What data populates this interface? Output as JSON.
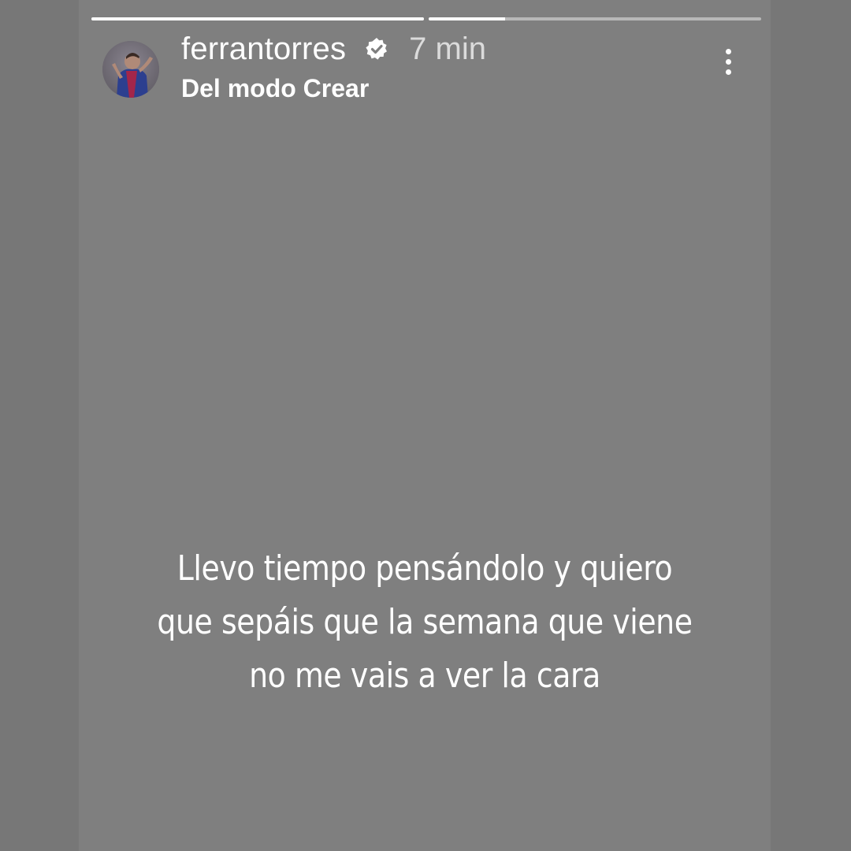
{
  "story": {
    "progress": [
      1.0,
      0.23
    ],
    "username": "ferrantorres",
    "verified": true,
    "time": "7 min",
    "subtitle": "Del modo Crear",
    "caption_lines": [
      "Llevo tiempo pensándolo y quiero",
      "que sepáis que la semana que viene",
      "no me vais a ver la cara"
    ]
  },
  "colors": {
    "page_bg": "#777777",
    "story_bg": "#7f7f7f",
    "text": "#ffffff"
  },
  "icons": {
    "verified": "verified-badge-icon",
    "more": "more-options-icon"
  }
}
